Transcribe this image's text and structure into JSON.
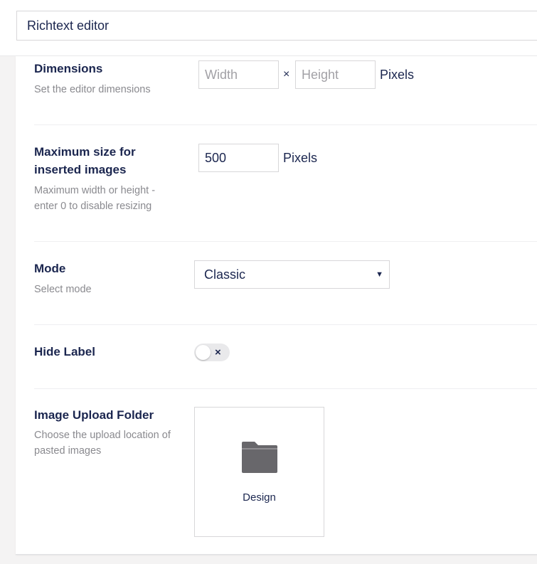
{
  "header": {
    "name_value": "Richtext editor"
  },
  "settings": {
    "dimensions": {
      "label": "Dimensions",
      "description": "Set the editor dimensions",
      "width_placeholder": "Width",
      "height_placeholder": "Height",
      "separator": "×",
      "unit": "Pixels"
    },
    "max_image_size": {
      "label": "Maximum size for inserted images",
      "description": "Maximum width or height - enter 0 to disable resizing",
      "value": "500",
      "unit": "Pixels"
    },
    "mode": {
      "label": "Mode",
      "description": "Select mode",
      "selected": "Classic",
      "caret": "▼"
    },
    "hide_label": {
      "label": "Hide Label",
      "toggle_on": false,
      "toggle_icon": "×"
    },
    "image_upload_folder": {
      "label": "Image Upload Folder",
      "description": "Choose the upload location of pasted images",
      "folder_name": "Design",
      "folder_icon": "folder-icon",
      "folder_color": "#68676b"
    }
  }
}
